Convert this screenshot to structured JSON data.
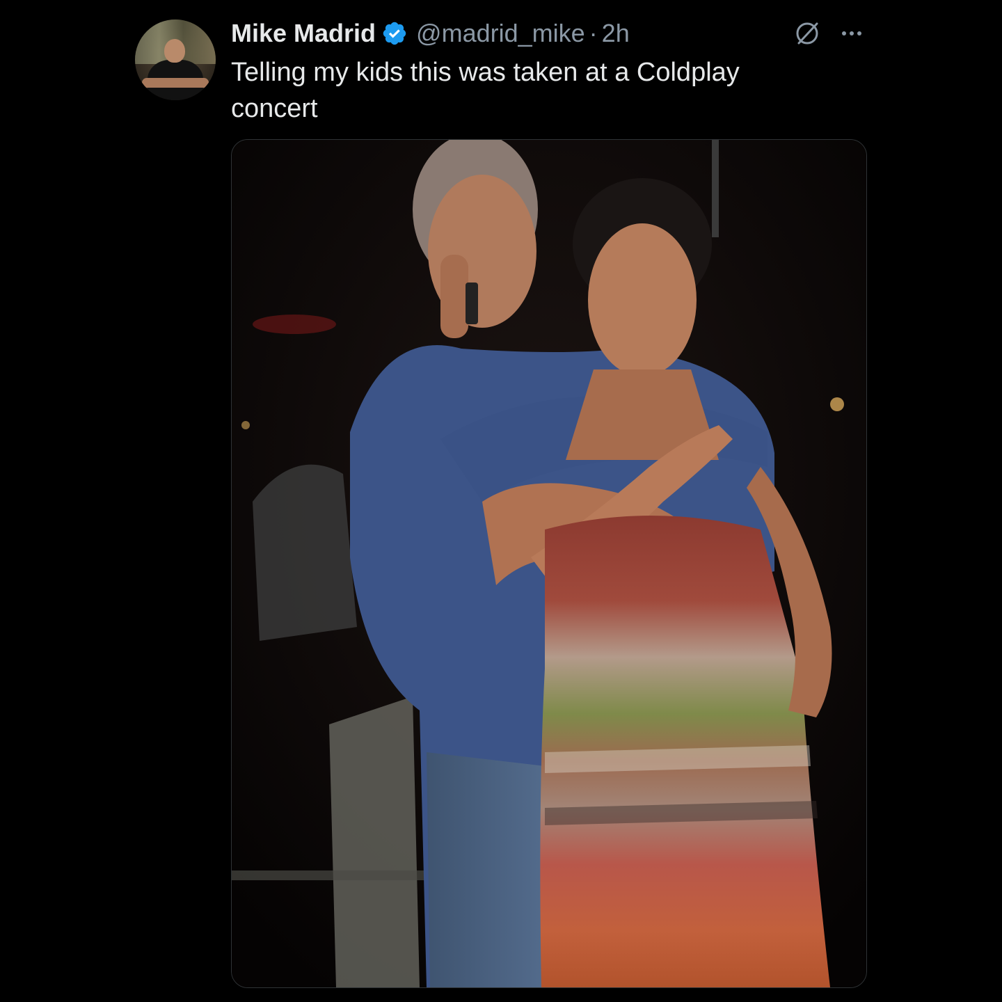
{
  "tweet": {
    "author_name": "Mike Madrid",
    "author_handle": "@madrid_mike",
    "separator": "·",
    "timestamp": "2h",
    "text": "Telling my kids this was taken at a Coldplay concert",
    "verified": true
  },
  "icons": {
    "verified": "verified-badge-icon",
    "grok": "grok-icon",
    "more": "more-options-icon"
  },
  "colors": {
    "background": "#000000",
    "primary_text": "#e7e9ea",
    "secondary_text": "#8b98a5",
    "verified_blue": "#1d9bf0",
    "border": "#2f3336"
  }
}
